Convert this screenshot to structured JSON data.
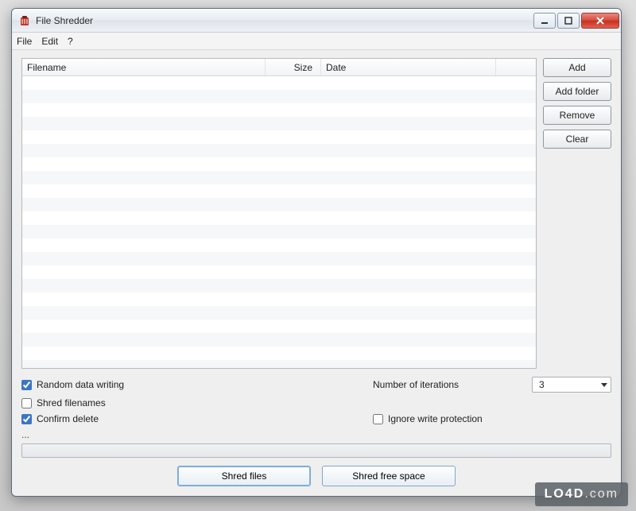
{
  "window": {
    "title": "File Shredder"
  },
  "menubar": {
    "file": "File",
    "edit": "Edit",
    "help": "?"
  },
  "columns": {
    "filename": "Filename",
    "size": "Size",
    "date": "Date"
  },
  "buttons": {
    "add": "Add",
    "add_folder": "Add folder",
    "remove": "Remove",
    "clear": "Clear"
  },
  "options": {
    "random_data_writing": {
      "label": "Random data writing",
      "checked": true
    },
    "shred_filenames": {
      "label": "Shred filenames",
      "checked": false
    },
    "confirm_delete": {
      "label": "Confirm delete",
      "checked": true
    },
    "iterations_label": "Number of iterations",
    "iterations_value": "3",
    "ignore_write_protection": {
      "label": "Ignore write protection",
      "checked": false
    }
  },
  "status_text": "...",
  "actions": {
    "shred_files": "Shred files",
    "shred_free_space": "Shred free space"
  },
  "watermark": {
    "brand": "LO4D",
    "suffix": ".com"
  }
}
